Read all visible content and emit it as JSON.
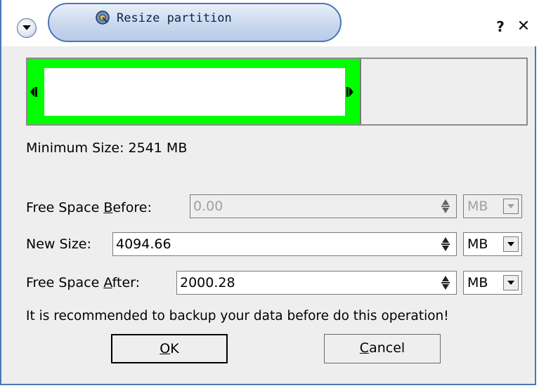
{
  "window": {
    "title": "Resize partition"
  },
  "partition": {
    "used_fraction": 0.67
  },
  "min_size_label": "Minimum Size: 2541 MB",
  "fields": {
    "before": {
      "label_pre": "Free Space ",
      "label_ul": "B",
      "label_post": "efore:",
      "value": "0.00",
      "unit": "MB",
      "disabled": true
    },
    "size": {
      "label": "New Size:",
      "value": "4094.66",
      "unit": "MB",
      "disabled": false
    },
    "after": {
      "label_pre": "Free Space ",
      "label_ul": "A",
      "label_post": "fter:",
      "value": "2000.28",
      "unit": "MB",
      "disabled": false
    }
  },
  "warning": "It is recommended to backup your data before do this operation!",
  "buttons": {
    "ok_ul": "O",
    "ok_rest": "K",
    "cancel_ul": "C",
    "cancel_rest": "ancel"
  },
  "colors": {
    "partition_fill": "#00ff00",
    "accent": "#4a76b8"
  },
  "icons": [
    "menu-icon",
    "partition-icon",
    "help-icon",
    "close-icon",
    "spin-arrows-icon",
    "dropdown-arrow-icon"
  ]
}
